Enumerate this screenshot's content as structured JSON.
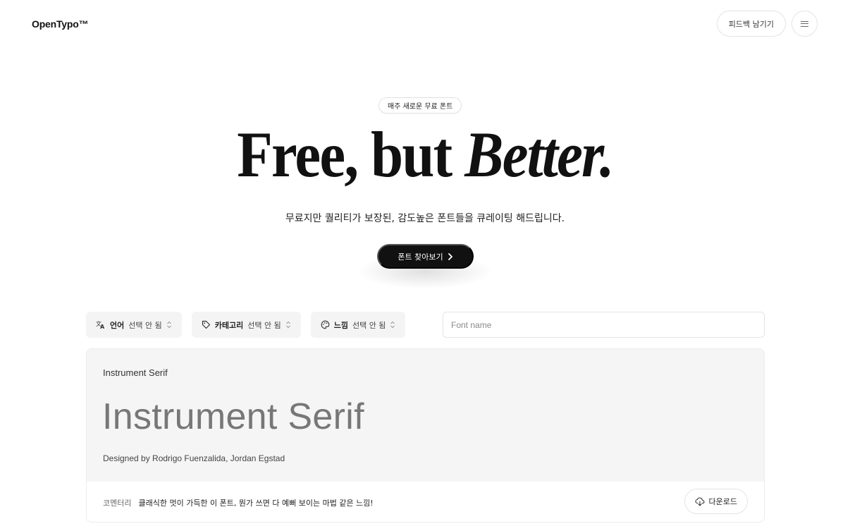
{
  "header": {
    "brand": "OpenTypo™",
    "feedback_label": "피드백 남기기",
    "menu_icon": "hamburger-menu-icon"
  },
  "hero": {
    "badge": "매주 새로운 무료 폰트",
    "title_plain": "Free, but ",
    "title_italic": "Better.",
    "subtitle": "무료지만 퀄리티가 보장된, 감도높은 폰트들을 큐레이팅 해드립니다.",
    "cta_label": "폰트 찾아보기",
    "cta_icon": "chevron-right-icon"
  },
  "filters": [
    {
      "icon": "translate-icon",
      "name": "언어",
      "state": "선택 안 됨"
    },
    {
      "icon": "tag-icon",
      "name": "카테고리",
      "state": "선택 안 됨"
    },
    {
      "icon": "palette-icon",
      "name": "느낌",
      "state": "선택 안 됨"
    }
  ],
  "search": {
    "placeholder": "Font name",
    "value": ""
  },
  "font_card": {
    "name": "Instrument Serif",
    "preview": "Instrument Serif",
    "designer": "Designed by Rodrigo Fuenzalida, Jordan Egstad",
    "comment_label": "코멘터리",
    "comment": "클래식한 멋이 가득한 이 폰트, 뭔가 쓰면 다 예뻐 보이는 마법 같은 느낌!",
    "download_label": "다운로드",
    "download_icon": "cloud-download-icon"
  }
}
